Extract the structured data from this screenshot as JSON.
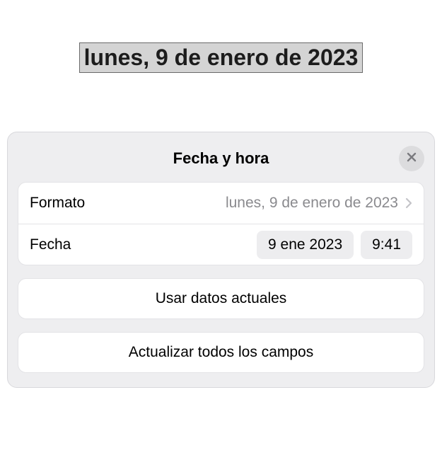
{
  "canvas": {
    "selected_text": "lunes, 9 de enero de 2023"
  },
  "sheet": {
    "title": "Fecha y hora",
    "rows": {
      "format": {
        "label": "Formato",
        "value": "lunes, 9 de enero de 2023"
      },
      "date": {
        "label": "Fecha",
        "date_chip": "9 ene 2023",
        "time_chip": "9:41"
      }
    },
    "actions": {
      "use_current": "Usar datos actuales",
      "update_all": "Actualizar todos los campos"
    }
  }
}
